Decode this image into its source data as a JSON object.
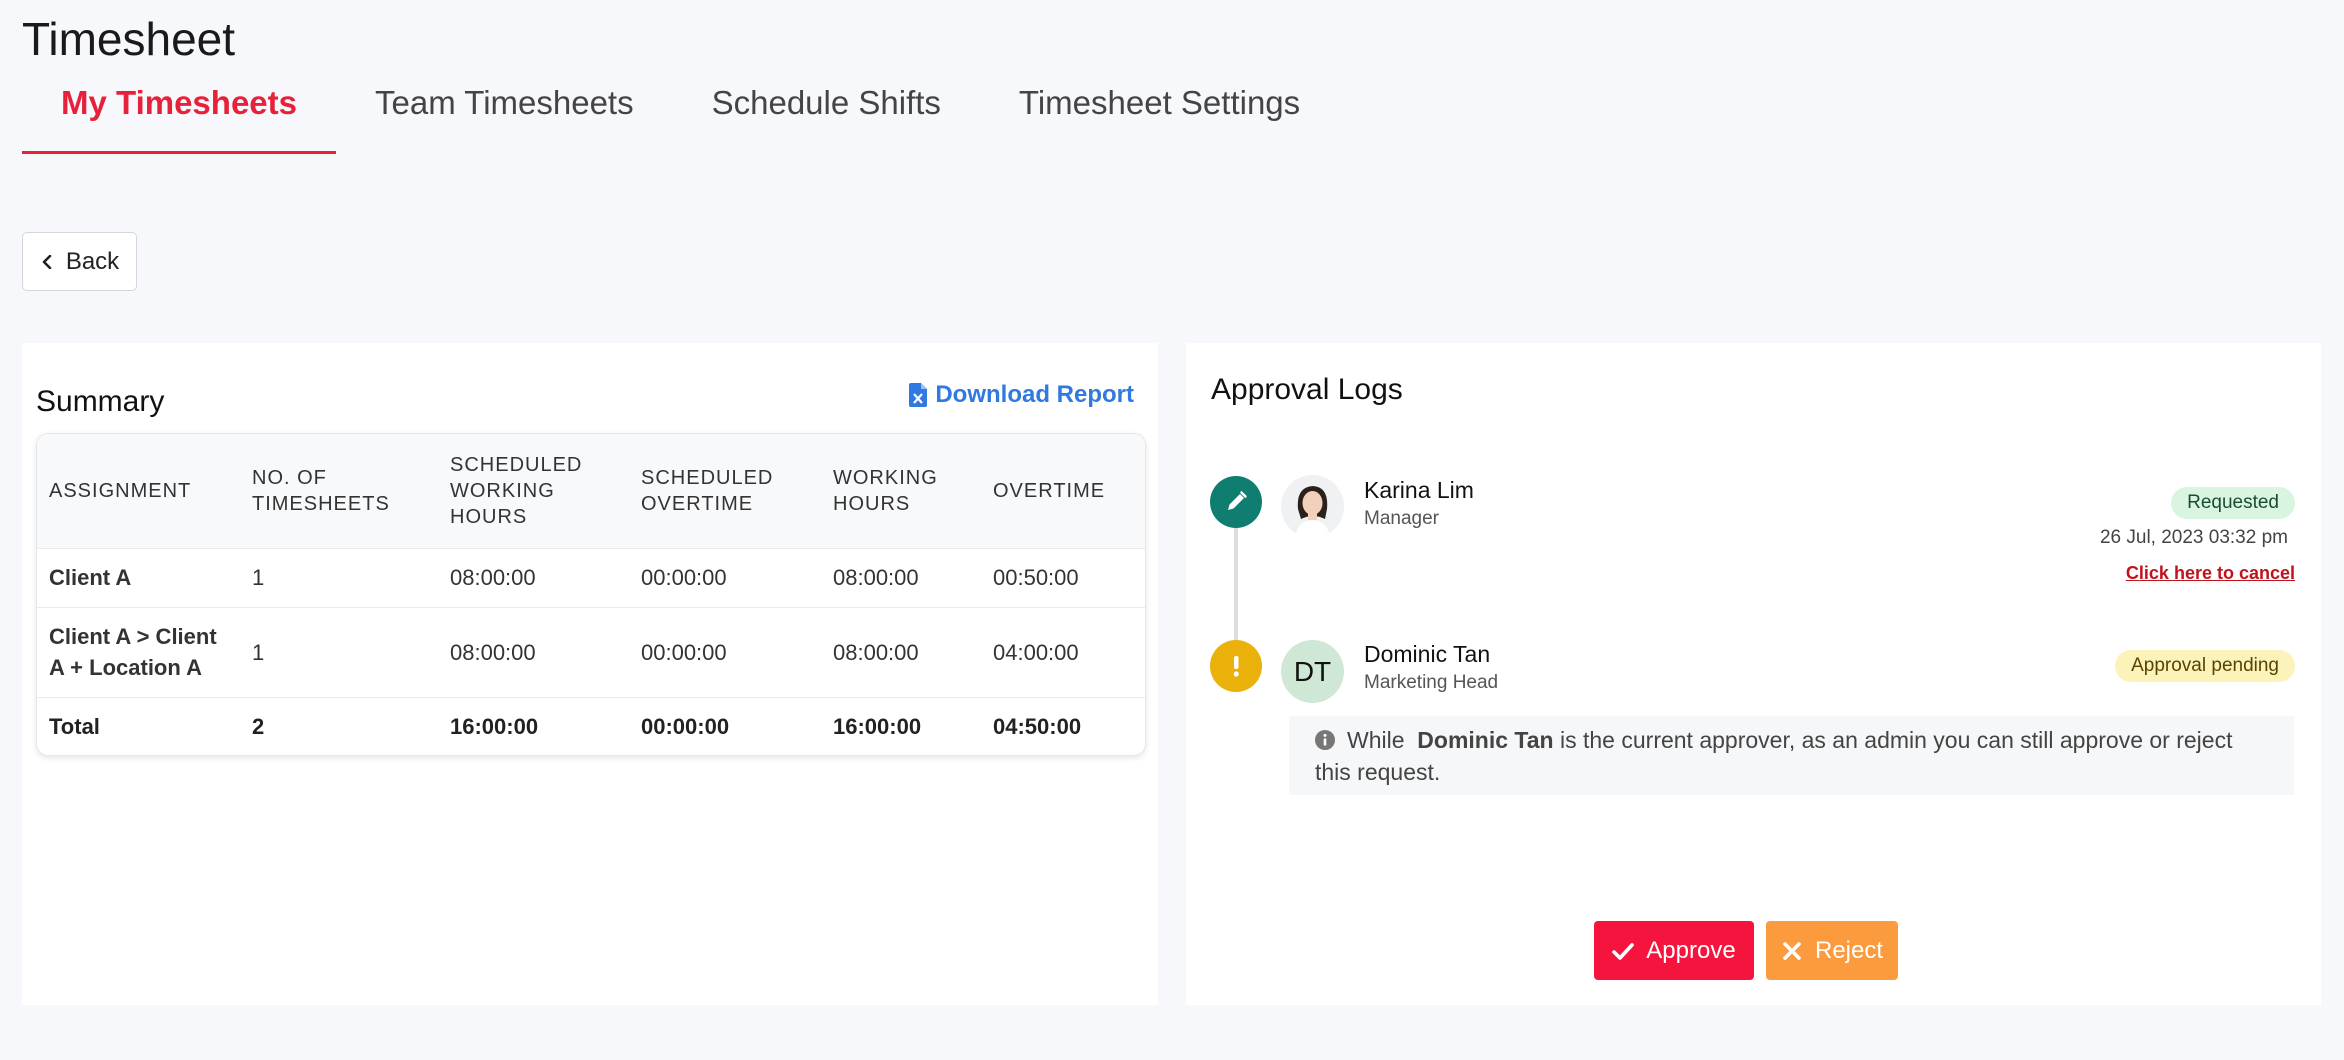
{
  "page": {
    "title": "Timesheet"
  },
  "tabs": [
    {
      "label": "My Timesheets",
      "active": true
    },
    {
      "label": "Team Timesheets",
      "active": false
    },
    {
      "label": "Schedule Shifts",
      "active": false
    },
    {
      "label": "Timesheet Settings",
      "active": false
    }
  ],
  "back_label": "Back",
  "summary": {
    "title": "Summary",
    "download_label": "Download Report",
    "columns": [
      "ASSIGNMENT",
      "NO. OF TIMESHEETS",
      "SCHEDULED WORKING HOURS",
      "SCHEDULED OVERTIME",
      "WORKING HOURS",
      "OVERTIME"
    ],
    "rows": [
      {
        "assignment": "Client A",
        "timesheets": "1",
        "scheduled_working_hours": "08:00:00",
        "scheduled_overtime": "00:00:00",
        "working_hours": "08:00:00",
        "overtime": "00:50:00"
      },
      {
        "assignment": "Client A > Client A + Location A",
        "timesheets": "1",
        "scheduled_working_hours": "08:00:00",
        "scheduled_overtime": "00:00:00",
        "working_hours": "08:00:00",
        "overtime": "04:00:00"
      }
    ],
    "total": {
      "label": "Total",
      "timesheets": "2",
      "scheduled_working_hours": "16:00:00",
      "scheduled_overtime": "00:00:00",
      "working_hours": "16:00:00",
      "overtime": "04:50:00"
    }
  },
  "approval": {
    "title": "Approval Logs",
    "logs": [
      {
        "name": "Karina Lim",
        "role": "Manager",
        "status": "Requested",
        "date": "26 Jul, 2023 03:32 pm",
        "cancel_label": "Click here to cancel",
        "status_icon": "pencil-icon"
      },
      {
        "name": "Dominic Tan",
        "role": "Marketing Head",
        "initials": "DT",
        "status": "Approval pending",
        "status_icon": "exclamation-icon"
      }
    ],
    "info": {
      "prefix": "While",
      "approver": "Dominic Tan",
      "suffix": "is the current approver, as an admin you can still approve or reject this request."
    },
    "approve_label": "Approve",
    "reject_label": "Reject"
  },
  "colors": {
    "accent": "#e8213b",
    "link": "#2f79e0",
    "approve": "#f4143e",
    "reject": "#fb9b3e",
    "requested_badge": "#d9f5e2",
    "pending_badge": "#fbf3b9",
    "edit_dot": "#0f7d6f",
    "warn_dot": "#e9b109"
  }
}
